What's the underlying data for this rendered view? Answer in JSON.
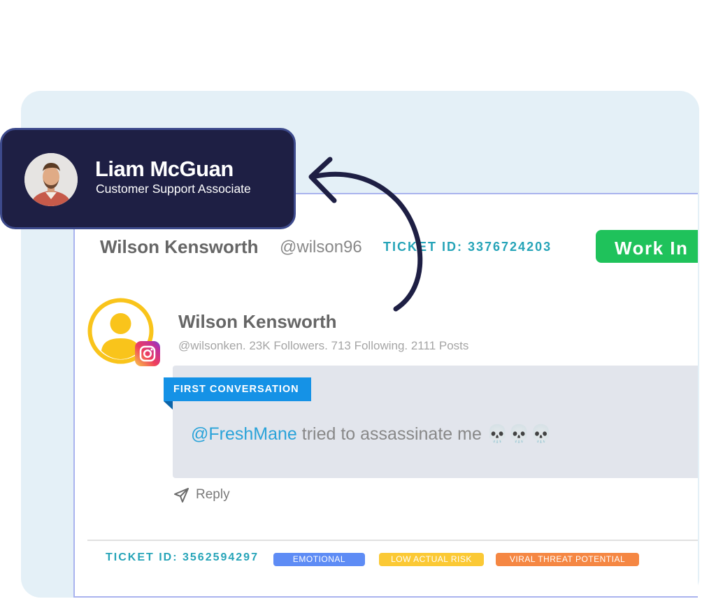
{
  "agent": {
    "name": "Liam McGuan",
    "role": "Customer Support Associate"
  },
  "ticket_header": {
    "customer_name": "Wilson Kensworth",
    "customer_handle": "@wilson96",
    "ticket_id": "TICKET ID: 3376724203",
    "status_button": "Work In"
  },
  "post": {
    "author_name": "Wilson Kensworth",
    "author_stats": "@wilsonken. 23K Followers. 713 Following. 2111 Posts",
    "platform_icon": "instagram-icon",
    "tag": "FIRST CONVERSATION",
    "mention": "@FreshMane",
    "message": " tried to assassinate me 💀💀💀",
    "reply_label": "Reply"
  },
  "next_ticket": {
    "ticket_id": "TICKET ID: 3562594297",
    "tags": [
      "EMOTIONAL",
      "LOW ACTUAL RISK",
      "VIRAL THREAT POTENTIAL"
    ]
  },
  "colors": {
    "agent_card": "#1e1f44",
    "status_green": "#1fc25b",
    "ticket_teal": "#26a4b8",
    "tag_blue": "#1592e6",
    "tag_emotional": "#5e8cf5",
    "tag_risk": "#fbc935",
    "tag_viral": "#f58743"
  }
}
